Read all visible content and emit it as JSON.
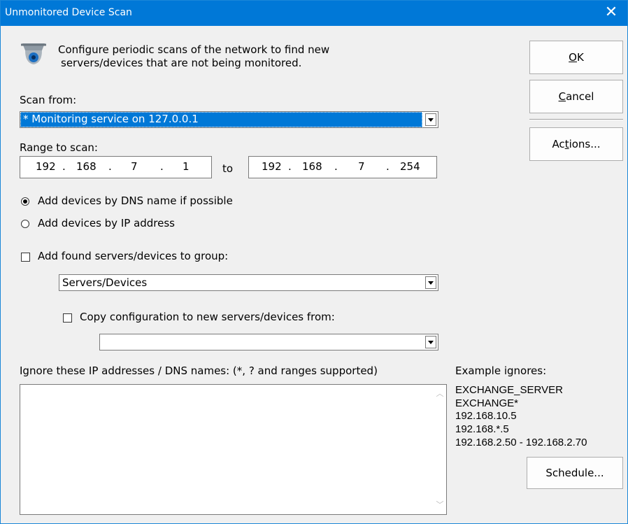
{
  "window": {
    "title": "Unmonitored Device Scan",
    "close_glyph": "✕"
  },
  "header": {
    "icon": "security-camera-icon",
    "line1": "Configure periodic scans of the network to find new",
    "line2": "servers/devices that are not being monitored."
  },
  "buttons": {
    "ok": {
      "pre": "",
      "acc": "O",
      "post": "K"
    },
    "cancel": {
      "pre": "",
      "acc": "C",
      "post": "ancel"
    },
    "actions": {
      "pre": "Ac",
      "acc": "t",
      "post": "ions..."
    },
    "schedule": "Schedule..."
  },
  "scan_from": {
    "label": "Scan from:",
    "value": "* Monitoring service on 127.0.0.1"
  },
  "range": {
    "label": "Range to scan:",
    "from": [
      "192",
      "168",
      "7",
      "1"
    ],
    "to_label": "to",
    "to": [
      "192",
      "168",
      "7",
      "254"
    ]
  },
  "add_mode": {
    "dns_label": "Add devices by DNS name if possible",
    "ip_label": "Add devices by IP address",
    "selected": "dns"
  },
  "group": {
    "check_label": "Add found servers/devices to group:",
    "checked": false,
    "value": "Servers/Devices",
    "copy_label": "Copy configuration to new servers/devices from:",
    "copy_checked": false,
    "copy_value": ""
  },
  "ignore": {
    "label": "Ignore these IP addresses / DNS names:  (*, ? and ranges supported)",
    "value": ""
  },
  "examples": {
    "title": "Example ignores:",
    "items": [
      "EXCHANGE_SERVER",
      "EXCHANGE*",
      "192.168.10.5",
      "192.168.*.5",
      "192.168.2.50 - 192.168.2.70"
    ]
  },
  "colors": {
    "titlebar": "#0078d7",
    "selection": "#0078d7",
    "dialog_bg": "#f0f0f0"
  }
}
